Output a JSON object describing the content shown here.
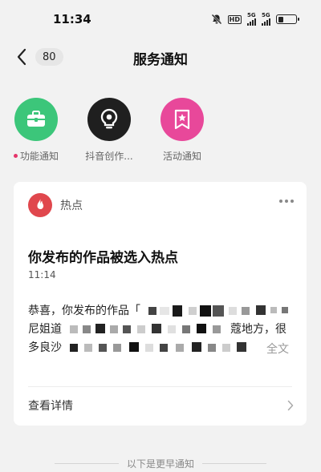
{
  "status_bar": {
    "time": "11:34",
    "hd_label": "HD",
    "signal1_label": "5G",
    "signal2_label": "5G",
    "battery_level": 0.3
  },
  "nav": {
    "back_icon": "chevron-left-icon",
    "count": "80",
    "title": "服务通知"
  },
  "categories": [
    {
      "label": "功能通知",
      "icon": "briefcase-icon",
      "color": "#3cc67a",
      "unread": true
    },
    {
      "label": "抖音创作...",
      "icon": "creator-bulb-icon",
      "color": "#1f1f1f",
      "unread": false
    },
    {
      "label": "活动通知",
      "icon": "bookmark-star-icon",
      "color": "#e8489a",
      "unread": false
    }
  ],
  "card": {
    "source": "热点",
    "source_icon": "flame-icon",
    "title": "你发布的作品被选入热点",
    "time": "11:14",
    "body_lines": [
      "恭喜，你发布的作品「",
      "尼姐道",
      "多良沙"
    ],
    "body_line2_end": "蔻地方，很",
    "read_more": "全文",
    "detail_label": "查看详情",
    "accent": "#e0474d"
  },
  "earlier_text": "以下是更早通知"
}
